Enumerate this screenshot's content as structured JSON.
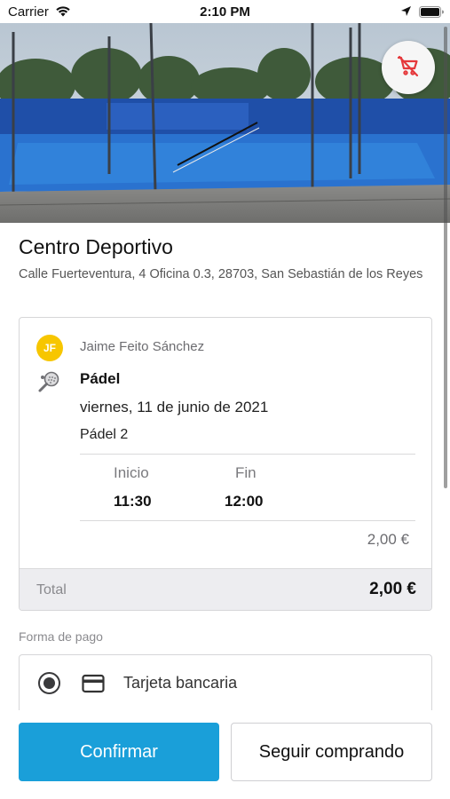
{
  "status_bar": {
    "carrier": "Carrier",
    "time": "2:10 PM"
  },
  "hero": {
    "action_icon": "cart-off-icon",
    "accent_color": "#e5383b"
  },
  "club": {
    "name": "Centro Deportivo",
    "address": "Calle Fuerteventura, 4 Oficina 0.3, 28703, San Sebastián de los Reyes"
  },
  "booking": {
    "user_initials": "JF",
    "user_name": "Jaime Feito Sánchez",
    "sport": "Pádel",
    "date": "viernes, 11 de junio de 2021",
    "court": "Pádel 2",
    "start_label": "Inicio",
    "end_label": "Fin",
    "start_time": "11:30",
    "end_time": "12:00",
    "price": "2,00 €",
    "total_label": "Total",
    "total_value": "2,00 €"
  },
  "payment": {
    "heading": "Forma de pago",
    "method_label": "Tarjeta bancaria",
    "selected": true
  },
  "actions": {
    "confirm_label": "Confirmar",
    "continue_label": "Seguir comprando",
    "primary_color": "#1a9fd9"
  }
}
